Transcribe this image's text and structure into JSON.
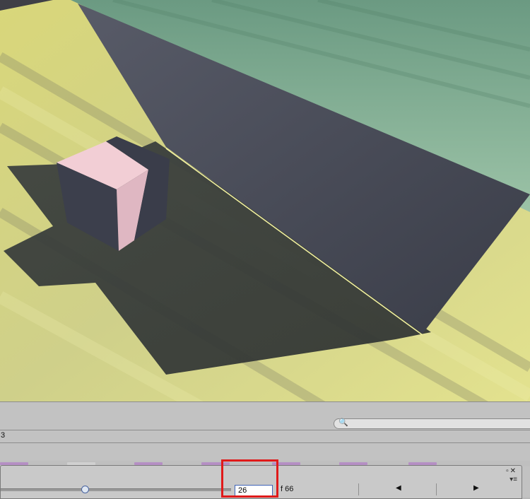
{
  "timeline": {
    "frame_label": "3",
    "current_frame": "26",
    "total_frames": "f 66",
    "prev_glyph": "◀",
    "next_glyph": "▶",
    "window_buttons": "▫✕",
    "menu_glyph": "▾≡",
    "search_glyph": "🔍",
    "slider_value_fraction": 0.37
  },
  "colors": {
    "highlight": "#e01a1a",
    "input_border": "#3f64b6",
    "clip": "#b58fc4"
  },
  "icons": [
    "search-icon",
    "maximize-icon",
    "close-icon",
    "panel-menu-icon",
    "prev-frame-icon",
    "next-frame-icon"
  ]
}
